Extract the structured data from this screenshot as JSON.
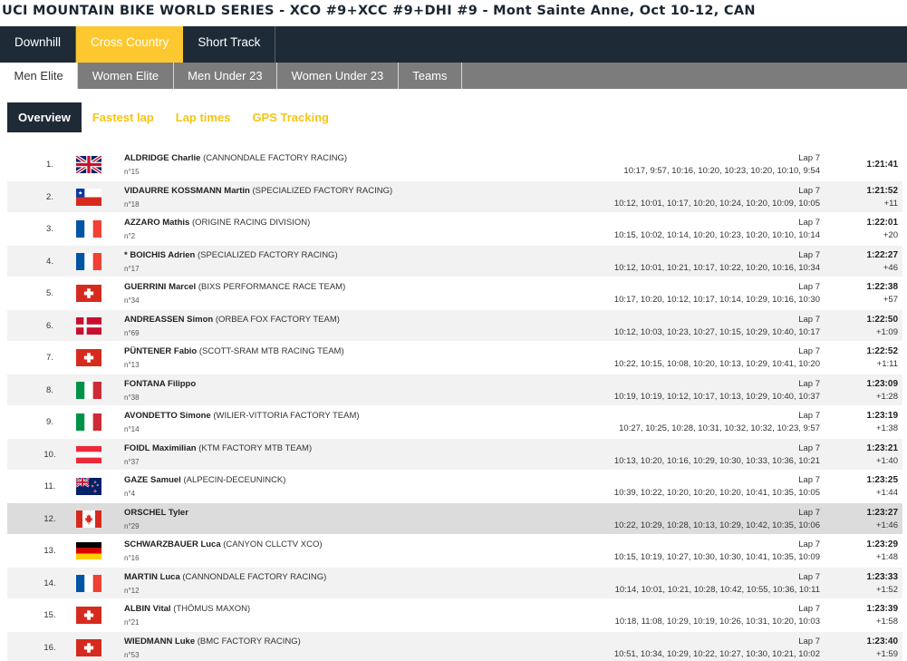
{
  "event_title": "UCI MOUNTAIN BIKE WORLD SERIES - XCO #9+XCC #9+DHI #9 - Mont Sainte Anne, Oct 10-12, CAN",
  "discipline_tabs": [
    {
      "label": "Downhill",
      "active": false
    },
    {
      "label": "Cross Country",
      "active": true
    },
    {
      "label": "Short Track",
      "active": false
    }
  ],
  "category_tabs": [
    {
      "label": "Men Elite",
      "active": true
    },
    {
      "label": "Women Elite",
      "active": false
    },
    {
      "label": "Men Under 23",
      "active": false
    },
    {
      "label": "Women Under 23",
      "active": false
    },
    {
      "label": "Teams",
      "active": false
    }
  ],
  "view_tabs": [
    {
      "label": "Overview",
      "active": true
    },
    {
      "label": "Fastest lap",
      "active": false
    },
    {
      "label": "Lap times",
      "active": false
    },
    {
      "label": "GPS Tracking",
      "active": false
    }
  ],
  "colors": {
    "navy": "#1f2a37",
    "yellow": "#fdc82f",
    "gray_tab": "#7c7c7c",
    "highlight_row": "#dcdcdc"
  },
  "results": [
    {
      "rank": "1.",
      "flag": "GBR",
      "name": "ALDRIDGE Charlie",
      "team": "(CANNONDALE FACTORY RACING)",
      "bib": "n°15",
      "lap": "Lap 7",
      "laps": "10:17, 9:57, 10:16, 10:20, 10:23, 10:20, 10:10, 9:54",
      "time": "1:21:41",
      "gap": ""
    },
    {
      "rank": "2.",
      "flag": "CHI",
      "name": "VIDAURRE KOSSMANN Martin",
      "team": "(SPECIALIZED FACTORY RACING)",
      "bib": "n°18",
      "lap": "Lap 7",
      "laps": "10:12, 10:01, 10:17, 10:20, 10:24, 10:20, 10:09, 10:05",
      "time": "1:21:52",
      "gap": "+11"
    },
    {
      "rank": "3.",
      "flag": "FRA",
      "name": "AZZARO Mathis",
      "team": "(ORIGINE RACING DIVISION)",
      "bib": "n°2",
      "lap": "Lap 7",
      "laps": "10:15, 10:02, 10:14, 10:20, 10:23, 10:20, 10:10, 10:14",
      "time": "1:22:01",
      "gap": "+20"
    },
    {
      "rank": "4.",
      "flag": "FRA",
      "name": "* BOICHIS Adrien",
      "team": "(SPECIALIZED FACTORY RACING)",
      "bib": "n°17",
      "lap": "Lap 7",
      "laps": "10:12, 10:01, 10:21, 10:17, 10:22, 10:20, 10:16, 10:34",
      "time": "1:22:27",
      "gap": "+46"
    },
    {
      "rank": "5.",
      "flag": "SUI",
      "name": "GUERRINI Marcel",
      "team": "(BIXS PERFORMANCE RACE TEAM)",
      "bib": "n°34",
      "lap": "Lap 7",
      "laps": "10:17, 10:20, 10:12, 10:17, 10:14, 10:29, 10:16, 10:30",
      "time": "1:22:38",
      "gap": "+57"
    },
    {
      "rank": "6.",
      "flag": "DEN",
      "name": "ANDREASSEN Simon",
      "team": "(ORBEA FOX FACTORY TEAM)",
      "bib": "n°69",
      "lap": "Lap 7",
      "laps": "10:12, 10:03, 10:23, 10:27, 10:15, 10:29, 10:40, 10:17",
      "time": "1:22:50",
      "gap": "+1:09"
    },
    {
      "rank": "7.",
      "flag": "SUI",
      "name": "PÜNTENER Fabio",
      "team": "(SCOTT-SRAM MTB RACING TEAM)",
      "bib": "n°13",
      "lap": "Lap 7",
      "laps": "10:22, 10:15, 10:08, 10:20, 10:13, 10:29, 10:41, 10:20",
      "time": "1:22:52",
      "gap": "+1:11"
    },
    {
      "rank": "8.",
      "flag": "ITA",
      "name": "FONTANA Filippo",
      "team": "",
      "bib": "n°38",
      "lap": "Lap 7",
      "laps": "10:19, 10:19, 10:12, 10:17, 10:13, 10:29, 10:40, 10:37",
      "time": "1:23:09",
      "gap": "+1:28"
    },
    {
      "rank": "9.",
      "flag": "ITA",
      "name": "AVONDETTO Simone",
      "team": "(WILIER-VITTORIA FACTORY TEAM)",
      "bib": "n°14",
      "lap": "Lap 7",
      "laps": "10:27, 10:25, 10:28, 10:31, 10:32, 10:32, 10:23, 9:57",
      "time": "1:23:19",
      "gap": "+1:38"
    },
    {
      "rank": "10.",
      "flag": "AUT",
      "name": "FOIDL Maximilian",
      "team": "(KTM FACTORY MTB TEAM)",
      "bib": "n°37",
      "lap": "Lap 7",
      "laps": "10:13, 10:20, 10:16, 10:29, 10:30, 10:33, 10:36, 10:21",
      "time": "1:23:21",
      "gap": "+1:40"
    },
    {
      "rank": "11.",
      "flag": "NZL",
      "name": "GAZE Samuel",
      "team": "(ALPECIN-DECEUNINCK)",
      "bib": "n°4",
      "lap": "Lap 7",
      "laps": "10:39, 10:22, 10:20, 10:20, 10:20, 10:41, 10:35, 10:05",
      "time": "1:23:25",
      "gap": "+1:44"
    },
    {
      "rank": "12.",
      "flag": "CAN",
      "name": "ORSCHEL Tyler",
      "team": "",
      "bib": "n°29",
      "lap": "Lap 7",
      "laps": "10:22, 10:29, 10:28, 10:13, 10:29, 10:42, 10:35, 10:06",
      "time": "1:23:27",
      "gap": "+1:46",
      "highlight": true
    },
    {
      "rank": "13.",
      "flag": "GER",
      "name": "SCHWARZBAUER Luca",
      "team": "(CANYON CLLCTV XCO)",
      "bib": "n°16",
      "lap": "Lap 7",
      "laps": "10:15, 10:19, 10:27, 10:30, 10:30, 10:41, 10:35, 10:09",
      "time": "1:23:29",
      "gap": "+1:48"
    },
    {
      "rank": "14.",
      "flag": "FRA",
      "name": "MARTIN Luca",
      "team": "(CANNONDALE FACTORY RACING)",
      "bib": "n°12",
      "lap": "Lap 7",
      "laps": "10:14, 10:01, 10:21, 10:28, 10:42, 10:55, 10:36, 10:11",
      "time": "1:23:33",
      "gap": "+1:52"
    },
    {
      "rank": "15.",
      "flag": "SUI",
      "name": "ALBIN Vital",
      "team": "(THÖMUS MAXON)",
      "bib": "n°21",
      "lap": "Lap 7",
      "laps": "10:18, 11:08, 10:29, 10:19, 10:26, 10:31, 10:20, 10:03",
      "time": "1:23:39",
      "gap": "+1:58"
    },
    {
      "rank": "16.",
      "flag": "SUI",
      "name": "WIEDMANN Luke",
      "team": "(BMC FACTORY RACING)",
      "bib": "n°53",
      "lap": "Lap 7",
      "laps": "10:51, 10:34, 10:29, 10:22, 10:27, 10:30, 10:21, 10:02",
      "time": "1:23:40",
      "gap": "+1:59"
    }
  ]
}
